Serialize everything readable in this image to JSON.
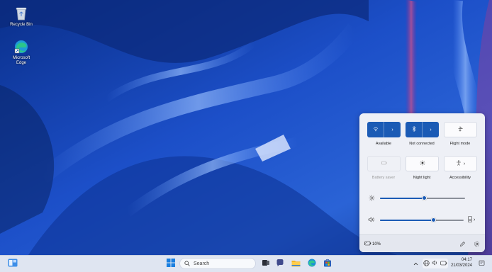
{
  "desktop": {
    "icons": [
      {
        "label": "Recycle Bin",
        "icon": "recycle-bin-icon"
      },
      {
        "label": "Microsoft Edge",
        "label_lines": [
          "Microsoft",
          "Edge"
        ],
        "icon": "edge-icon"
      }
    ]
  },
  "quick_settings": {
    "tiles": [
      {
        "name": "wifi",
        "label": "Available",
        "state": "on",
        "icon": "wifi-icon"
      },
      {
        "name": "bluetooth",
        "label": "Not connected",
        "state": "on",
        "icon": "bluetooth-icon"
      },
      {
        "name": "flight-mode",
        "label": "Flight mode",
        "state": "off",
        "icon": "airplane-icon"
      },
      {
        "name": "battery-saver",
        "label": "Battery saver",
        "state": "disabled",
        "icon": "battery-saver-icon"
      },
      {
        "name": "night-light",
        "label": "Night light",
        "state": "off",
        "icon": "brightness-icon"
      },
      {
        "name": "accessibility",
        "label": "Accessibility",
        "state": "off",
        "icon": "accessibility-icon"
      }
    ],
    "brightness": {
      "level": 0.52,
      "icon": "sun-icon"
    },
    "volume": {
      "level": 0.64,
      "icon": "speaker-icon"
    },
    "battery_text": "10%",
    "footer_icons": [
      "edit-icon",
      "settings-icon"
    ]
  },
  "taskbar": {
    "search_placeholder": "Search",
    "clock_time": "04:17",
    "clock_date": "21/03/2024",
    "accent": "#1b5bb5"
  }
}
